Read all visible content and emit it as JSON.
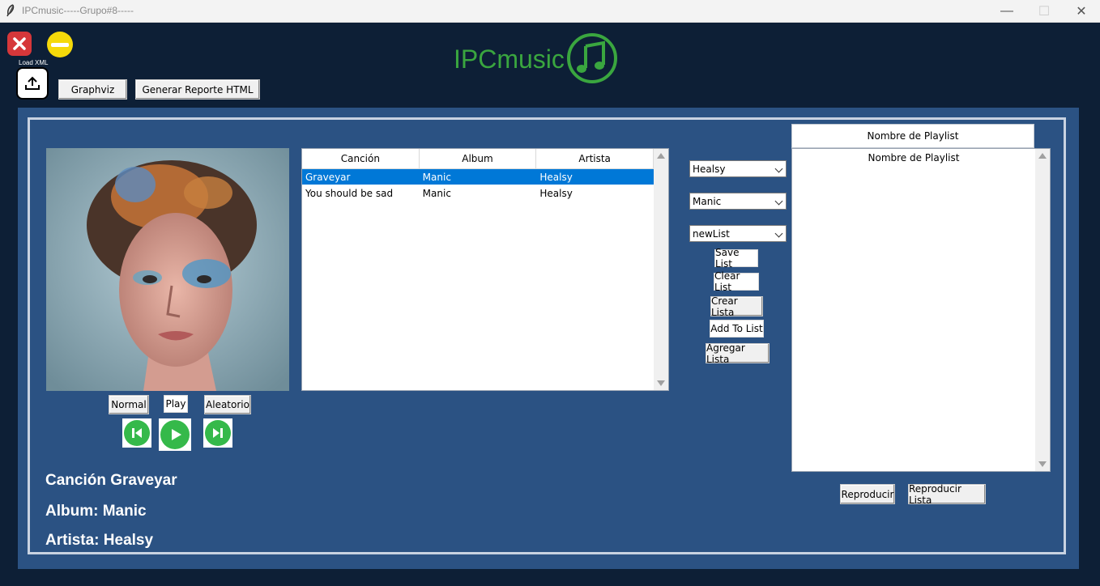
{
  "window": {
    "title": "IPCmusic-----Grupo#8-----"
  },
  "toolbar": {
    "load_xml_label": "Load XML",
    "graphviz_label": "Graphviz",
    "report_label": "Generar Reporte HTML"
  },
  "logo": {
    "text": "IPCmusic"
  },
  "table": {
    "columns": [
      "Canción",
      "Album",
      "Artista"
    ],
    "rows": [
      {
        "song": "Graveyar",
        "album": "Manic",
        "artist": "Healsy",
        "selected": true
      },
      {
        "song": "You should be sad",
        "album": "Manic",
        "artist": "Healsy",
        "selected": false
      }
    ]
  },
  "controls": {
    "normal_label": "Normal",
    "play_label": "Play",
    "aleatorio_label": "Aleatorio"
  },
  "now_playing": {
    "song_line": "Canción Graveyar",
    "album_line": "Album: Manic",
    "artist_line": "Artista: Healsy"
  },
  "selectors": {
    "artist": "Healsy",
    "album": "Manic",
    "list": "newList"
  },
  "list_buttons": {
    "save": "Save List",
    "clear": "Clear List",
    "create": "Crear Lista",
    "add": "Add To List",
    "agregar": "Agregar Lista"
  },
  "playlist": {
    "header": "Nombre de Playlist",
    "items": [
      "Nombre de Playlist"
    ],
    "play_label": "Reproducir",
    "play_list_label": "Reproducir Lista"
  },
  "colors": {
    "accent_green": "#3aa63f",
    "panel_blue": "#2b5283",
    "background": "#0d1f36",
    "selection": "#0078d7"
  }
}
